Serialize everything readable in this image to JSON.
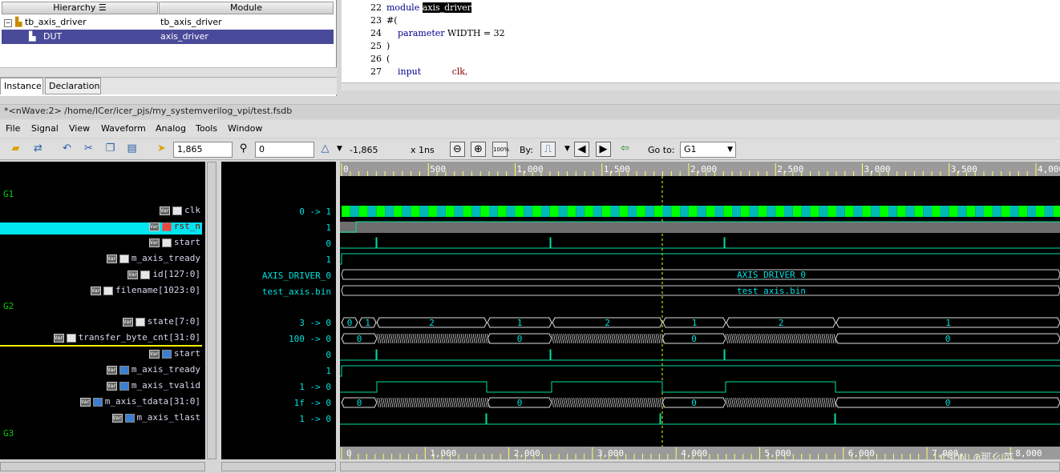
{
  "hierarchy": {
    "col_hierarchy": "Hierarchy",
    "col_module": "Module",
    "rows": [
      {
        "instance": "tb_axis_driver",
        "module": "tb_axis_driver"
      },
      {
        "instance": "DUT",
        "module": "axis_driver"
      }
    ],
    "tabs": [
      "Instance",
      "Declaration"
    ]
  },
  "source": {
    "lines": [
      {
        "num": "22",
        "kw": "module",
        "code": " ",
        "hl": "axis_driver"
      },
      {
        "num": "23",
        "code": "#("
      },
      {
        "num": "24",
        "kw": "    parameter",
        "code": " WIDTH = 32"
      },
      {
        "num": "25",
        "code": ")"
      },
      {
        "num": "26",
        "code": "("
      },
      {
        "num": "27",
        "kw": "    input",
        "code": "           clk,"
      }
    ]
  },
  "window_title": "*<nWave:2> /home/ICer/icer_pjs/my_systemverilog_vpi/test.fsdb",
  "menu": [
    "File",
    "Signal",
    "View",
    "Waveform",
    "Analog",
    "Tools",
    "Window"
  ],
  "toolbar": {
    "cursor_time": "1,865",
    "marker_time": "0",
    "delta": "-1,865",
    "unit": "x 1ns",
    "by_label": "By:",
    "goto_label": "Go to:",
    "goto_value": "G1"
  },
  "groups": [
    "G1",
    "G2",
    "G3"
  ],
  "signals": [
    {
      "name": "clk",
      "value": "0 -> 1"
    },
    {
      "name": "rst_n",
      "value": "1"
    },
    {
      "name": "start",
      "value": "0"
    },
    {
      "name": "m_axis_tready",
      "value": "1"
    },
    {
      "name": "id[127:0]",
      "value": "AXIS_DRIVER_0"
    },
    {
      "name": "filename[1023:0]",
      "value": "test_axis.bin"
    },
    {
      "name": "state[7:0]",
      "value": "3 -> 0"
    },
    {
      "name": "transfer_byte_cnt[31:0]",
      "value": "100 -> 0"
    },
    {
      "name": "start",
      "value": "0"
    },
    {
      "name": "m_axis_tready",
      "value": "1"
    },
    {
      "name": "m_axis_tvalid",
      "value": "1 -> 0"
    },
    {
      "name": "m_axis_tdata[31:0]",
      "value": "1f -> 0"
    },
    {
      "name": "m_axis_tlast",
      "value": "1 -> 0"
    }
  ],
  "timeline_top": [
    "0",
    "500",
    "1,000",
    "1,500",
    "2,000",
    "2,500",
    "3,000",
    "3,500",
    "4,000"
  ],
  "timeline_bottom": [
    "0",
    "1,000",
    "2,000",
    "3,000",
    "4,000",
    "5,000",
    "6,000",
    "7,000",
    "8,000"
  ],
  "bus_labels": {
    "id": "AXIS_DRIVER_0",
    "filename": "test_axis.bin",
    "state": [
      "0",
      "1",
      "2",
      "1",
      "2",
      "1",
      "2",
      "1"
    ],
    "cnt": [
      "0",
      "0",
      "0",
      "0"
    ],
    "tdata": [
      "0",
      "0",
      "0",
      "0"
    ]
  },
  "watermark": "CSDN @那么菜",
  "colors": {
    "clk": "#00ff00",
    "wave": "#00e0a0",
    "bg": "#000000",
    "ruler": "#9a9a9a",
    "cursor": "#ffff00"
  }
}
